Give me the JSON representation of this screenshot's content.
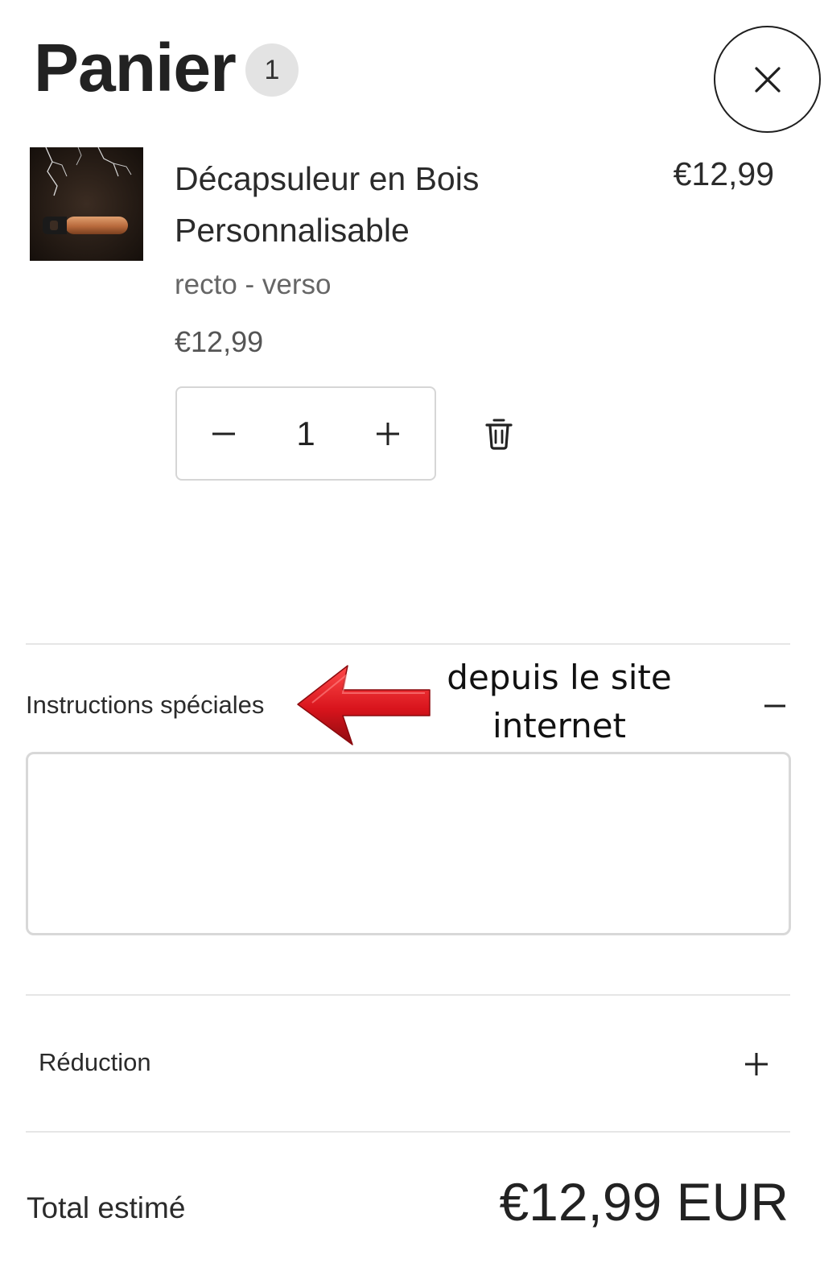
{
  "header": {
    "title": "Panier",
    "item_count": "1",
    "close_icon": "close-icon"
  },
  "cart": {
    "items": [
      {
        "name": "Décapsuleur en Bois Personnalisable",
        "line_price": "€12,99",
        "variant": "recto - verso",
        "unit_price": "€12,99",
        "quantity": "1"
      }
    ]
  },
  "instructions": {
    "label": "Instructions spéciales",
    "value": "",
    "toggle_icon": "minus-icon"
  },
  "annotation": {
    "text": "depuis le site internet",
    "arrow_color": "#d8141c"
  },
  "reduction": {
    "label": "Réduction",
    "toggle_icon": "plus-icon"
  },
  "total": {
    "label": "Total estimé",
    "value": "€12,99 EUR"
  }
}
